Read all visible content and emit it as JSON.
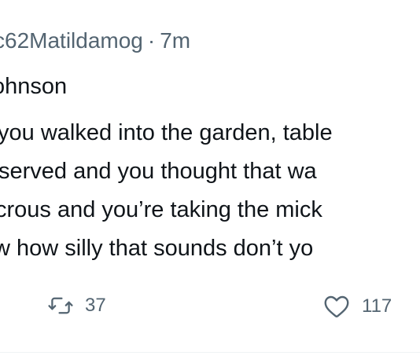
{
  "tweet": {
    "handle": "c62Matildamog",
    "separator": "·",
    "time": "7m",
    "name_fragment": "ohnson",
    "body_lines": [
      "you walked into the garden, table",
      " served and you thought that wa",
      "crous and you’re taking the mick",
      "w how silly that sounds don’t yo"
    ]
  },
  "actions": {
    "retweet": {
      "icon": "retweet-icon",
      "count": "37"
    },
    "like": {
      "icon": "heart-icon",
      "count": "117"
    }
  },
  "colors": {
    "text_primary": "#0f1419",
    "text_secondary": "#536471",
    "divider": "#eff3f4"
  }
}
